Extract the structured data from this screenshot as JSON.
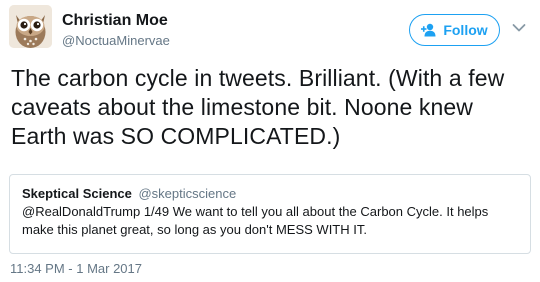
{
  "author": {
    "display_name": "Christian Moe",
    "screen_name": "@NoctuaMinervae",
    "avatar": "owl-avatar-icon"
  },
  "header": {
    "follow_label": "Follow",
    "follow_icon": "add-user-icon",
    "menu_icon": "chevron-down-icon"
  },
  "tweet": {
    "text": "The carbon cycle in tweets. Brilliant. (With a few caveats about the limestone bit. Noone knew Earth was SO COMPLICATED.)",
    "timestamp": "11:34 PM - 1 Mar 2017"
  },
  "quoted_tweet": {
    "display_name": "Skeptical Science",
    "screen_name": "@skepticscience",
    "text": "@RealDonaldTrump 1/49 We want to tell you all about the Carbon Cycle. It helps make this planet great, so long as you don't MESS WITH IT."
  },
  "colors": {
    "accent": "#1da1f2",
    "secondary_text": "#657786",
    "primary_text": "#14171a",
    "border": "#d6dee3"
  }
}
